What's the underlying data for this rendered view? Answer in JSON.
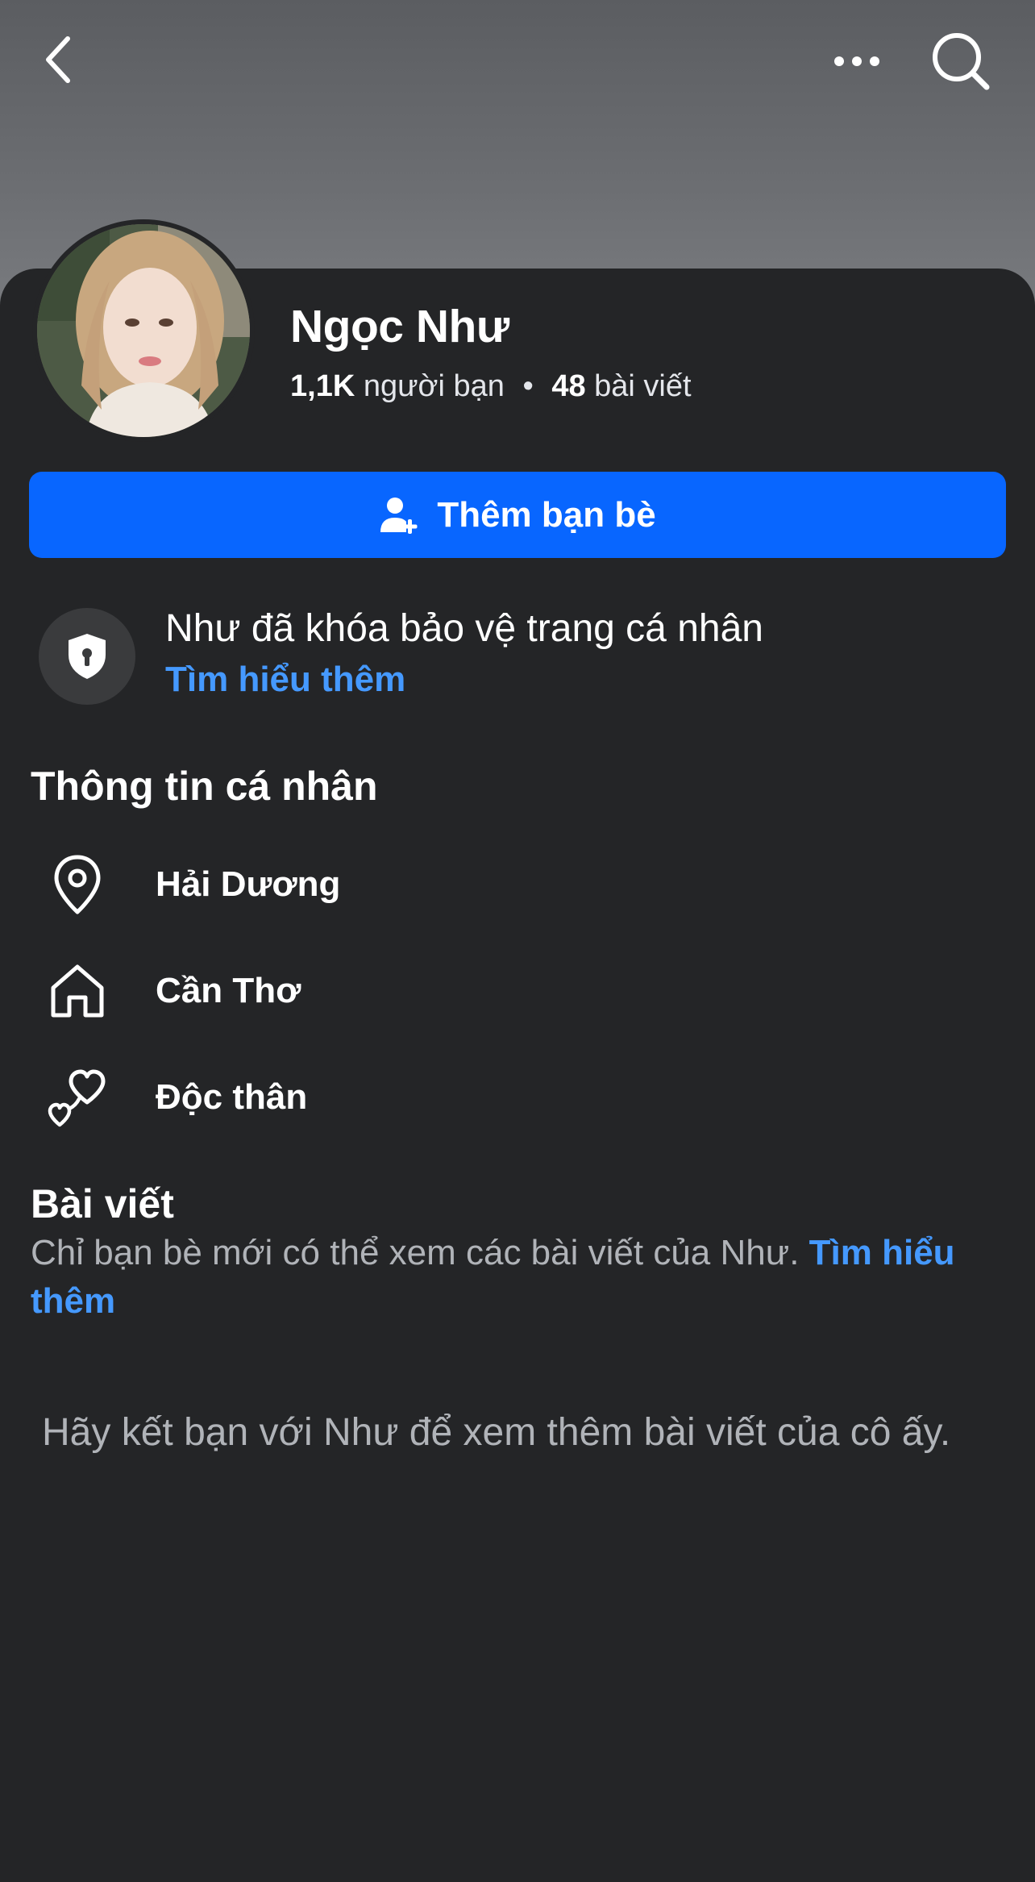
{
  "header": {
    "back_icon": "chevron-left-icon",
    "more_icon": "more-horizontal-icon",
    "search_icon": "search-icon"
  },
  "profile": {
    "name": "Ngọc Như",
    "friends_count": "1,1K",
    "friends_label": "người bạn",
    "separator": "•",
    "posts_count": "48",
    "posts_label": "bài viết"
  },
  "actions": {
    "add_friend_label": "Thêm bạn bè",
    "add_friend_icon": "add-person-icon",
    "accent_color": "#0866ff"
  },
  "lock_notice": {
    "icon": "shield-lock-icon",
    "title": "Như đã khóa bảo vệ trang cá nhân",
    "link": "Tìm hiểu thêm"
  },
  "personal_info": {
    "title": "Thông tin cá nhân",
    "items": [
      {
        "icon": "location-pin-icon",
        "label": "Hải Dương"
      },
      {
        "icon": "home-icon",
        "label": "Cần Thơ"
      },
      {
        "icon": "hearts-icon",
        "label": "Độc thân"
      }
    ]
  },
  "posts": {
    "title": "Bài viết",
    "description": "Chỉ bạn bè mới có thể xem các bài viết của Như.",
    "link": "Tìm hiểu thêm",
    "link_color": "#4599ff",
    "friend_prompt": "Hãy kết bạn với Như để xem thêm bài viết của cô ấy."
  }
}
